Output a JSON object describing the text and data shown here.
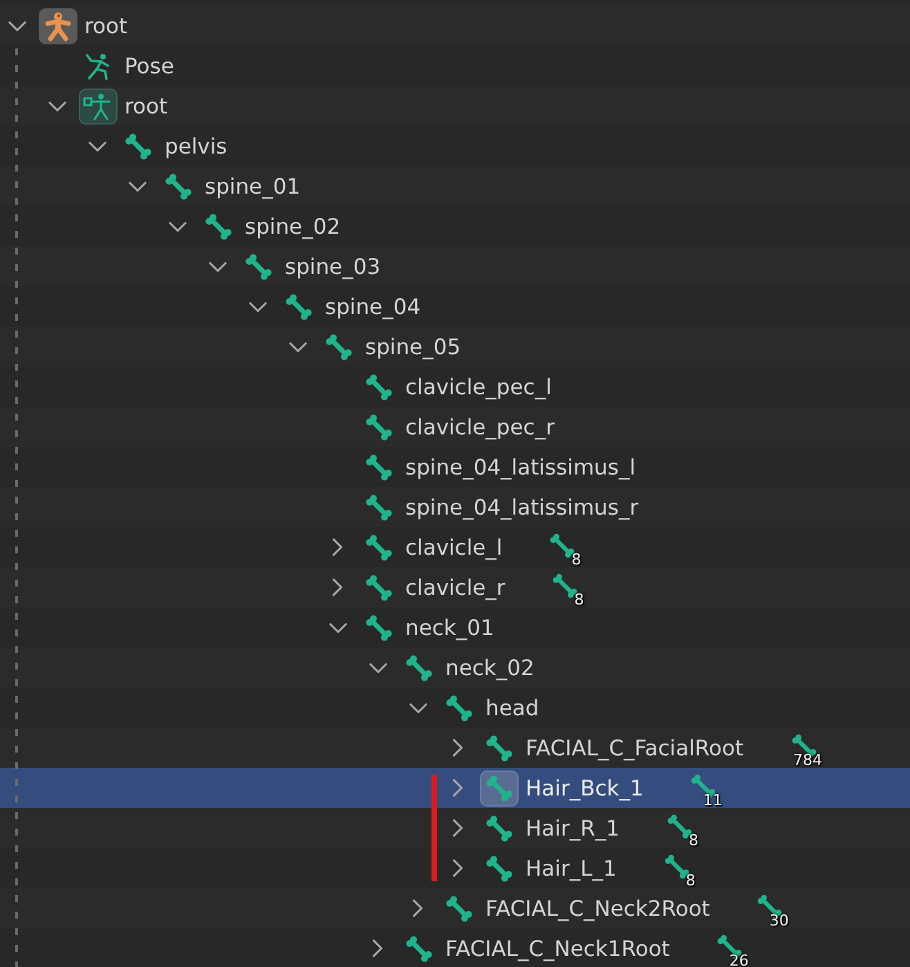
{
  "tree": [
    {
      "label": "root",
      "kind": "object",
      "expanded": true,
      "active": true,
      "selected": false,
      "children": [
        {
          "label": "Pose",
          "kind": "pose",
          "active": false,
          "selected": false
        },
        {
          "label": "root",
          "kind": "armature",
          "expanded": true,
          "active": true,
          "selected": false,
          "children": [
            {
              "label": "pelvis",
              "kind": "bone",
              "expanded": true,
              "active": false,
              "selected": false,
              "children": [
                {
                  "label": "spine_01",
                  "kind": "bone",
                  "expanded": true,
                  "active": false,
                  "selected": false,
                  "children": [
                    {
                      "label": "spine_02",
                      "kind": "bone",
                      "expanded": true,
                      "active": false,
                      "selected": false,
                      "children": [
                        {
                          "label": "spine_03",
                          "kind": "bone",
                          "expanded": true,
                          "active": false,
                          "selected": false,
                          "children": [
                            {
                              "label": "spine_04",
                              "kind": "bone",
                              "expanded": true,
                              "active": false,
                              "selected": false,
                              "children": [
                                {
                                  "label": "spine_05",
                                  "kind": "bone",
                                  "expanded": true,
                                  "active": false,
                                  "selected": false,
                                  "children": [
                                    {
                                      "label": "clavicle_pec_l",
                                      "kind": "bone",
                                      "active": false,
                                      "selected": false
                                    },
                                    {
                                      "label": "clavicle_pec_r",
                                      "kind": "bone",
                                      "active": false,
                                      "selected": false
                                    },
                                    {
                                      "label": "spine_04_latissimus_l",
                                      "kind": "bone",
                                      "active": false,
                                      "selected": false
                                    },
                                    {
                                      "label": "spine_04_latissimus_r",
                                      "kind": "bone",
                                      "active": false,
                                      "selected": false
                                    },
                                    {
                                      "label": "clavicle_l",
                                      "kind": "bone",
                                      "expanded": false,
                                      "active": false,
                                      "selected": false,
                                      "count": "8"
                                    },
                                    {
                                      "label": "clavicle_r",
                                      "kind": "bone",
                                      "expanded": false,
                                      "active": false,
                                      "selected": false,
                                      "count": "8"
                                    },
                                    {
                                      "label": "neck_01",
                                      "kind": "bone",
                                      "expanded": true,
                                      "active": false,
                                      "selected": false,
                                      "children": [
                                        {
                                          "label": "neck_02",
                                          "kind": "bone",
                                          "expanded": true,
                                          "active": false,
                                          "selected": false,
                                          "children": [
                                            {
                                              "label": "head",
                                              "kind": "bone",
                                              "expanded": true,
                                              "active": false,
                                              "selected": false,
                                              "children": [
                                                {
                                                  "label": "FACIAL_C_FacialRoot",
                                                  "kind": "bone",
                                                  "expanded": false,
                                                  "active": false,
                                                  "selected": false,
                                                  "count": "784"
                                                },
                                                {
                                                  "label": "Hair_Bck_1",
                                                  "kind": "bone",
                                                  "expanded": false,
                                                  "active": true,
                                                  "selected": true,
                                                  "count": "11"
                                                },
                                                {
                                                  "label": "Hair_R_1",
                                                  "kind": "bone",
                                                  "expanded": false,
                                                  "active": false,
                                                  "selected": false,
                                                  "count": "8"
                                                },
                                                {
                                                  "label": "Hair_L_1",
                                                  "kind": "bone",
                                                  "expanded": false,
                                                  "active": false,
                                                  "selected": false,
                                                  "count": "8"
                                                }
                                              ]
                                            },
                                            {
                                              "label": "FACIAL_C_Neck2Root",
                                              "kind": "bone",
                                              "expanded": false,
                                              "active": false,
                                              "selected": false,
                                              "count": "30"
                                            }
                                          ]
                                        },
                                        {
                                          "label": "FACIAL_C_Neck1Root",
                                          "kind": "bone",
                                          "expanded": false,
                                          "active": false,
                                          "selected": false,
                                          "count": "26"
                                        }
                                      ]
                                    }
                                  ]
                                }
                              ]
                            }
                          ]
                        }
                      ]
                    }
                  ]
                }
              ]
            }
          ]
        }
      ]
    }
  ]
}
